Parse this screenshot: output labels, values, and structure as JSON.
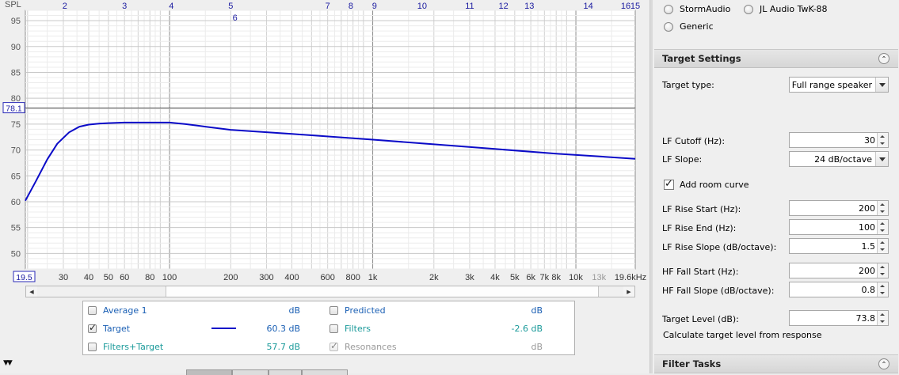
{
  "chart_data": {
    "type": "line",
    "ylabel": "SPL",
    "xunit": "kHz",
    "xscale": "log",
    "xlim": [
      19.5,
      19600
    ],
    "ylim": [
      47,
      97
    ],
    "y_ticks": [
      95,
      90,
      85,
      80,
      75,
      70,
      65,
      60,
      55,
      50
    ],
    "x_tick_labels": [
      {
        "x": 30,
        "label": "30"
      },
      {
        "x": 40,
        "label": "40"
      },
      {
        "x": 50,
        "label": "50"
      },
      {
        "x": 60,
        "label": "60"
      },
      {
        "x": 80,
        "label": "80"
      },
      {
        "x": 100,
        "label": "100"
      },
      {
        "x": 200,
        "label": "200"
      },
      {
        "x": 300,
        "label": "300"
      },
      {
        "x": 400,
        "label": "400"
      },
      {
        "x": 600,
        "label": "600"
      },
      {
        "x": 800,
        "label": "800"
      },
      {
        "x": 1000,
        "label": "1k"
      },
      {
        "x": 2000,
        "label": "2k"
      },
      {
        "x": 3000,
        "label": "3k"
      },
      {
        "x": 4000,
        "label": "4k"
      },
      {
        "x": 5000,
        "label": "5k"
      },
      {
        "x": 6000,
        "label": "6k"
      },
      {
        "x": 7000,
        "label": "7k"
      },
      {
        "x": 8000,
        "label": "8k"
      },
      {
        "x": 10000,
        "label": "10k"
      },
      {
        "x": 13000,
        "label": "13k",
        "muted": true
      }
    ],
    "x_min_label": "19.5",
    "x_max_label": "19.6kHz",
    "y_marker": {
      "value": 78.1,
      "label": "78.1"
    },
    "top_markers": [
      {
        "x": 30.5,
        "label": "2"
      },
      {
        "x": 60,
        "label": "3"
      },
      {
        "x": 102,
        "label": "4"
      },
      {
        "x": 200,
        "label": "5"
      },
      {
        "x": 210,
        "label": "6",
        "row": 2
      },
      {
        "x": 600,
        "label": "7"
      },
      {
        "x": 780,
        "label": "8"
      },
      {
        "x": 1020,
        "label": "9"
      },
      {
        "x": 1750,
        "label": "10"
      },
      {
        "x": 3000,
        "label": "11"
      },
      {
        "x": 4400,
        "label": "12"
      },
      {
        "x": 5900,
        "label": "13"
      },
      {
        "x": 11500,
        "label": "14"
      },
      {
        "x": 19600,
        "label": "15"
      },
      {
        "x": 25900,
        "label": "16"
      }
    ],
    "series": [
      {
        "color": "#0b0bc8",
        "x": [
          19.5,
          22,
          25,
          28,
          32,
          36,
          40,
          45,
          50,
          60,
          80,
          100,
          120,
          150,
          200,
          400,
          1000,
          2000,
          4000,
          8000,
          19600
        ],
        "y": [
          60.2,
          64.0,
          68.2,
          71.2,
          73.4,
          74.5,
          74.9,
          75.1,
          75.2,
          75.3,
          75.3,
          75.3,
          75.0,
          74.5,
          73.9,
          73.1,
          72.0,
          71.1,
          70.2,
          69.3,
          68.3
        ]
      }
    ]
  },
  "legend": {
    "items": [
      {
        "label": "Average 1",
        "value": "dB",
        "checked": false
      },
      {
        "label": "Predicted",
        "value": "dB",
        "checked": false
      },
      {
        "label": "Target",
        "value": "60.3 dB",
        "checked": true,
        "line_color": "#0b0bc8"
      },
      {
        "label": "Filters",
        "value": "-2.6 dB",
        "checked": false
      },
      {
        "label": "Filters+Target",
        "value": "57.7 dB",
        "checked": false
      },
      {
        "label": "Resonances",
        "value": "dB",
        "checked": true,
        "disabled": true
      }
    ]
  },
  "panel": {
    "radios": {
      "stormaudio": "StormAudio",
      "jl_audio": "JL Audio TwK-88",
      "generic": "Generic"
    },
    "target_settings": {
      "title": "Target Settings",
      "target_type_label": "Target type:",
      "target_type_value": "Full range speaker",
      "lf_cutoff_label": "LF Cutoff (Hz):",
      "lf_cutoff_value": "30",
      "lf_slope_label": "LF Slope:",
      "lf_slope_value": "24 dB/octave",
      "add_room_curve_label": "Add room curve",
      "lf_rise_start_label": "LF Rise Start (Hz):",
      "lf_rise_start_value": "200",
      "lf_rise_end_label": "LF Rise End (Hz):",
      "lf_rise_end_value": "100",
      "lf_rise_slope_label": "LF Rise Slope (dB/octave):",
      "lf_rise_slope_value": "1.5",
      "hf_fall_start_label": "HF Fall Start (Hz):",
      "hf_fall_start_value": "200",
      "hf_fall_slope_label": "HF Fall Slope (dB/octave):",
      "hf_fall_slope_value": "0.8",
      "target_level_label": "Target Level (dB):",
      "target_level_value": "73.8",
      "calc_label": "Calculate target level from response"
    },
    "filter_tasks": {
      "title": "Filter Tasks"
    }
  }
}
